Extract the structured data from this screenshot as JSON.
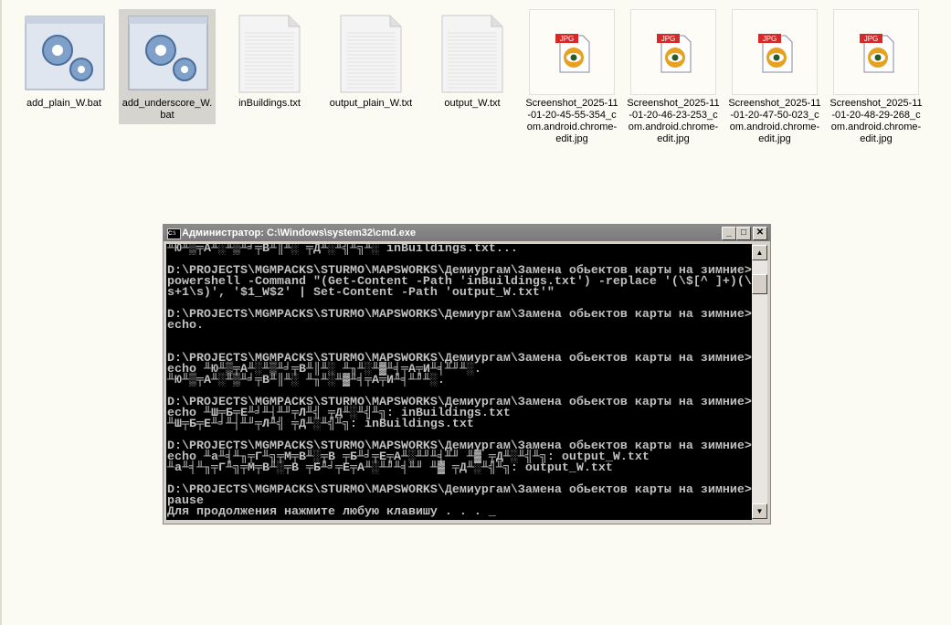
{
  "files": [
    {
      "name": "add_plain_W.bat",
      "type": "bat"
    },
    {
      "name": "add_underscore_W.bat",
      "type": "bat",
      "selected": true
    },
    {
      "name": "inBuildings.txt",
      "type": "txt"
    },
    {
      "name": "output_plain_W.txt",
      "type": "txt"
    },
    {
      "name": "output_W.txt",
      "type": "txt"
    },
    {
      "name": "Screenshot_2025-11-01-20-45-55-354_com.android.chrome-edit.jpg",
      "type": "jpg",
      "badge": "JPG"
    },
    {
      "name": "Screenshot_2025-11-01-20-46-23-253_com.android.chrome-edit.jpg",
      "type": "jpg",
      "badge": "JPG"
    },
    {
      "name": "Screenshot_2025-11-01-20-47-50-023_com.android.chrome-edit.jpg",
      "type": "jpg",
      "badge": "JPG"
    },
    {
      "name": "Screenshot_2025-11-01-20-48-29-268_com.android.chrome-edit.jpg",
      "type": "jpg",
      "badge": "JPG"
    }
  ],
  "cmd": {
    "title": "Администратор: C:\\Windows\\system32\\cmd.exe",
    "icon_label": "C:\\",
    "lines": [
      "╨Ю╨▒╤А╨░╨▒╨╛╤В╨║╨░ ╤Д╨░╨╣╨╗╨░ inBuildings.txt...",
      "",
      "D:\\PROJECTS\\MGMPACKS\\STURMO\\MAPSWORKS\\Демиургам\\Замена обьектов карты на зимние>",
      "powershell -Command \"(Get-Content -Path 'inBuildings.txt') -replace '(\\$[^ ]+)(\\",
      "s+1\\s)', '$1_W$2' | Set-Content -Path 'output_W.txt'\"",
      "",
      "D:\\PROJECTS\\MGMPACKS\\STURMO\\MAPSWORKS\\Демиургам\\Замена обьектов карты на зимние>",
      "echo.",
      "",
      "",
      "D:\\PROJECTS\\MGMPACKS\\STURMO\\MAPSWORKS\\Демиургам\\Замена обьектов карты на зимние>",
      "echo ╨Ю╨▒╤А╨░╨▒╨╛╤В╨║╨░ ╨╖╨░╨▓╨╡╤А╤И╨╡╨╜╨░.",
      "╨Ю╨▒╤А╨░╨▒╨╛╤В╨║╨░ ╨╖╨░╨▓╨╡╤А╤И╨╡╨╜╨░.",
      "",
      "D:\\PROJECTS\\MGMPACKS\\STURMO\\MAPSWORKS\\Демиургам\\Замена обьектов карты на зимние>",
      "echo ╨Ш╤Б╤Е╨╛╨┤╨╜╤Л╨╣ ╤Д╨░╨╣╨╗: inBuildings.txt",
      "╨Ш╤Б╤Е╨╛╨┤╨╜╤Л╨╣ ╤Д╨░╨╣╨╗: inBuildings.txt",
      "",
      "D:\\PROJECTS\\MGMPACKS\\STURMO\\MAPSWORKS\\Демиургам\\Замена обьектов карты на зимние>",
      "echo ╨а╨╡╨╖╤Г╨╗╤М╤В╨░╤В ╤Б╨╛╤Е╤А╨░╨╜╨╡╨╜ ╨▓ ╤Д╨░╨╣╨╗: output_W.txt",
      "╨а╨╡╨╖╤Г╨╗╤М╤В╨░╤В ╤Б╨╛╤Е╤А╨░╨╜╨╡╨╜ ╨▓ ╤Д╨░╨╣╨╗: output_W.txt",
      "",
      "D:\\PROJECTS\\MGMPACKS\\STURMO\\MAPSWORKS\\Демиургам\\Замена обьектов карты на зимние>",
      "pause",
      "Для продолжения нажмите любую клавишу . . . _"
    ]
  }
}
